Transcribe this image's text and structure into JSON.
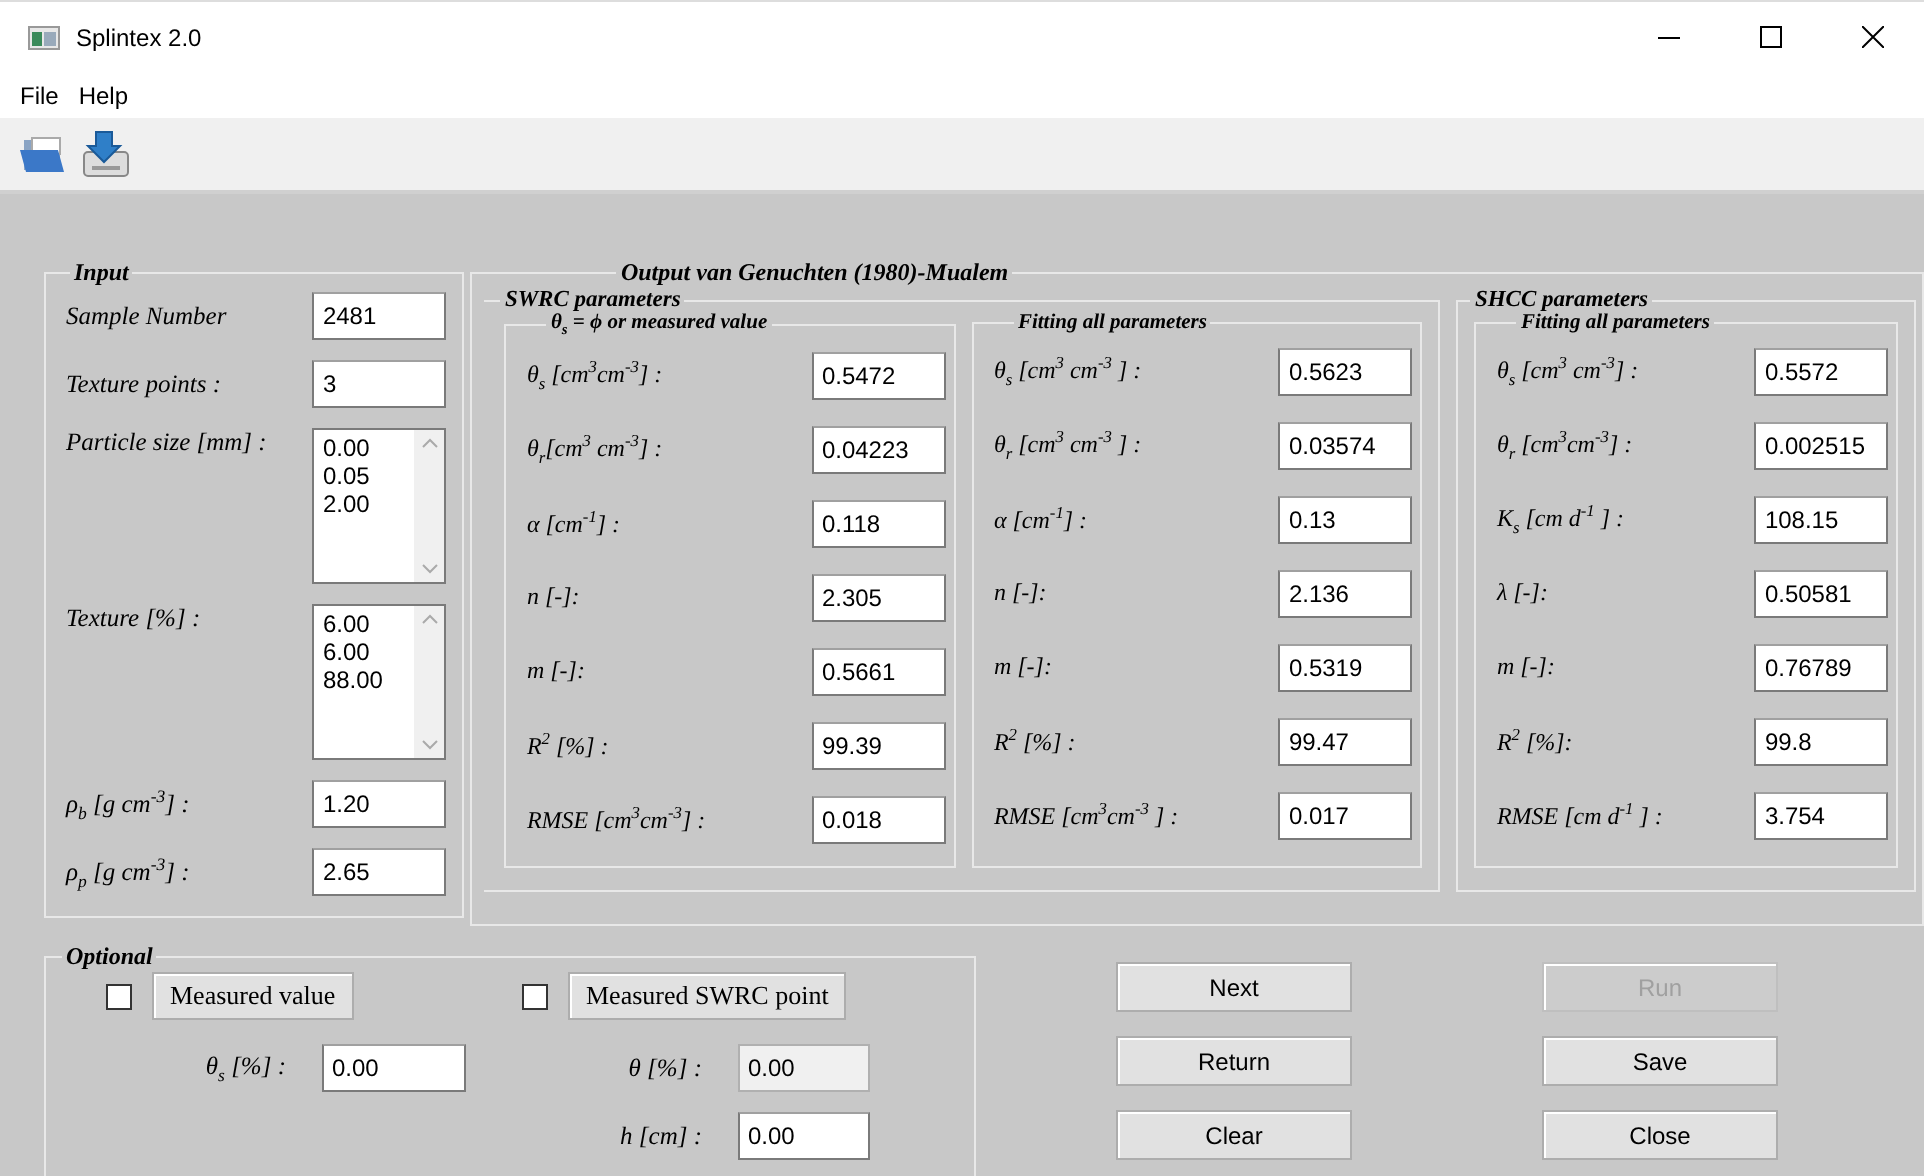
{
  "window": {
    "title": "Splintex 2.0"
  },
  "menu": [
    "File",
    "Help"
  ],
  "input": {
    "title": "Input",
    "fields": [
      {
        "kind": "field",
        "label": "Sample Number",
        "value": "2481"
      },
      {
        "kind": "field",
        "label": "Texture points :",
        "value": "3"
      },
      {
        "kind": "list",
        "label": "Particle size [mm] :",
        "values": [
          "0.00",
          "0.05",
          "2.00"
        ]
      },
      {
        "kind": "list",
        "label": "Texture [%] :",
        "values": [
          "6.00",
          "6.00",
          "88.00"
        ]
      },
      {
        "kind": "field",
        "label": "ρ$_{b}$  [g cm$^{-3}$] :",
        "value": "1.20"
      },
      {
        "kind": "field",
        "label": "ρ$_{p}$  [g cm$^{-3}$] :",
        "value": "2.65"
      }
    ]
  },
  "output": {
    "title": "Output van Genuchten (1980)-Mualem",
    "swrc": {
      "title": "SWRC parameters",
      "groups": [
        {
          "title": "**θ$_{s}$ = ϕ** or measured value",
          "rows": [
            {
              "label": "θ$_{s}$ [cm$^{3}$cm$^{-3}$] :",
              "value": "0.5472"
            },
            {
              "label": "θ$_{r}$[cm$^{3}$ cm$^{-3}$] :",
              "value": "0.04223"
            },
            {
              "label": "α [cm$^{-1}$] :",
              "value": "0.118"
            },
            {
              "label": "n  [-]:",
              "value": "2.305"
            },
            {
              "label": "m  [-]:",
              "value": "0.5661"
            },
            {
              "label": "R$^{2}$  [%] :",
              "value": "99.39"
            },
            {
              "label": "RMSE  [cm$^{3}$cm$^{-3}$] :",
              "value": "0.018"
            }
          ]
        },
        {
          "title": "Fitting all parameters",
          "rows": [
            {
              "label": "θ$_{s}$ [cm$^{3}$ cm$^{-3}$ ] :",
              "value": "0.5623"
            },
            {
              "label": "θ$_{r}$ [cm$^{3}$ cm$^{-3}$ ] :",
              "value": "0.03574"
            },
            {
              "label": "α [cm$^{-1}$] :",
              "value": "0.13"
            },
            {
              "label": "n  [-]:",
              "value": "2.136"
            },
            {
              "label": "m  [-]:",
              "value": "0.5319"
            },
            {
              "label": "R$^{2}$  [%] :",
              "value": "99.47"
            },
            {
              "label": "RMSE [cm$^{3}$cm$^{-3}$ ] :",
              "value": "0.017"
            }
          ]
        }
      ]
    },
    "shcc": {
      "title": "SHCC parameters",
      "groups": [
        {
          "title": "Fitting all parameters",
          "rows": [
            {
              "label": "θ$_{s}$  [cm$^{3}$ cm$^{-3}$] :",
              "value": "0.5572"
            },
            {
              "label": "θ$_{r}$  [cm$^{3}$cm$^{-3}$] :",
              "value": "0.002515"
            },
            {
              "label": "K$_{s}$  [cm d$^{-1}$ ] :",
              "value": "108.15"
            },
            {
              "label": "λ  [-]:",
              "value": "0.50581"
            },
            {
              "label": "m  [-]:",
              "value": "0.76789"
            },
            {
              "label": "R$^{2}$  [%]:",
              "value": "99.8"
            },
            {
              "label": "RMSE  [cm d$^{-1}$ ] :",
              "value": "3.754"
            }
          ]
        }
      ]
    }
  },
  "optional": {
    "title": "Optional",
    "options": [
      {
        "checked": false,
        "label": "Measured value",
        "fields": [
          {
            "label": "θ$_{s}$  [%] :",
            "value": "0.00",
            "disabled": false
          }
        ]
      },
      {
        "checked": false,
        "label": "Measured SWRC point",
        "fields": [
          {
            "label": "θ  [%] :",
            "value": "0.00",
            "disabled": true
          },
          {
            "label": "h [cm] :",
            "value": "0.00",
            "disabled": false
          }
        ]
      }
    ]
  },
  "buttons": [
    {
      "label": "Next",
      "disabled": false
    },
    {
      "label": "Run",
      "disabled": true
    },
    {
      "label": "Return",
      "disabled": false
    },
    {
      "label": "Save",
      "disabled": false
    },
    {
      "label": "Clear",
      "disabled": false
    },
    {
      "label": "Close",
      "disabled": false
    }
  ]
}
